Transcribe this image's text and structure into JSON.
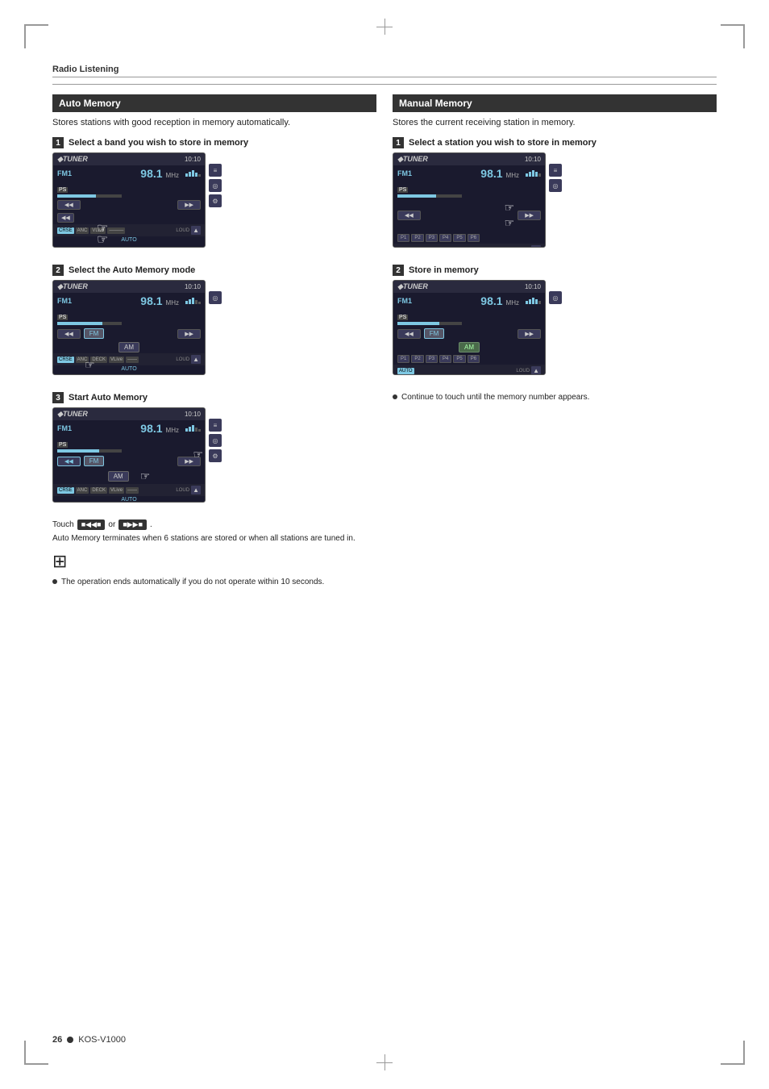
{
  "page": {
    "title": "Radio Listening",
    "page_number": "26",
    "model": "KOS-V1000"
  },
  "auto_memory": {
    "title": "Auto Memory",
    "description": "Stores stations with good reception in memory automatically.",
    "steps": [
      {
        "number": "1",
        "label": "Select a band you wish to store in memory"
      },
      {
        "number": "2",
        "label": "Select the Auto Memory mode"
      },
      {
        "number": "3",
        "label": "Start Auto Memory"
      }
    ],
    "touch_instruction": "Touch",
    "touch_or": "or",
    "touch_end_note": "Auto Memory terminates when 6 stations are stored or when all stations are tuned in.",
    "bullet_note": "The operation ends automatically if you do not operate within 10 seconds."
  },
  "manual_memory": {
    "title": "Manual Memory",
    "description": "Stores the current receiving station in memory.",
    "steps": [
      {
        "number": "1",
        "label": "Select a station you wish to store in memory"
      },
      {
        "number": "2",
        "label": "Store in memory"
      }
    ],
    "continue_note": "Continue to touch until the memory number appears."
  },
  "tuner": {
    "logo": "TUNER",
    "band": "FM1",
    "freq": "98.1",
    "unit": "MHz",
    "time": "10:10",
    "ps": "PS",
    "auto_label": "AUTO",
    "am_label": "AM",
    "fm_label": "FM",
    "presets": [
      "P1",
      "P2",
      "P3",
      "P4",
      "P5",
      "P6"
    ],
    "sources": [
      "CRSE",
      "ANC",
      "DECK",
      "VLive"
    ]
  }
}
